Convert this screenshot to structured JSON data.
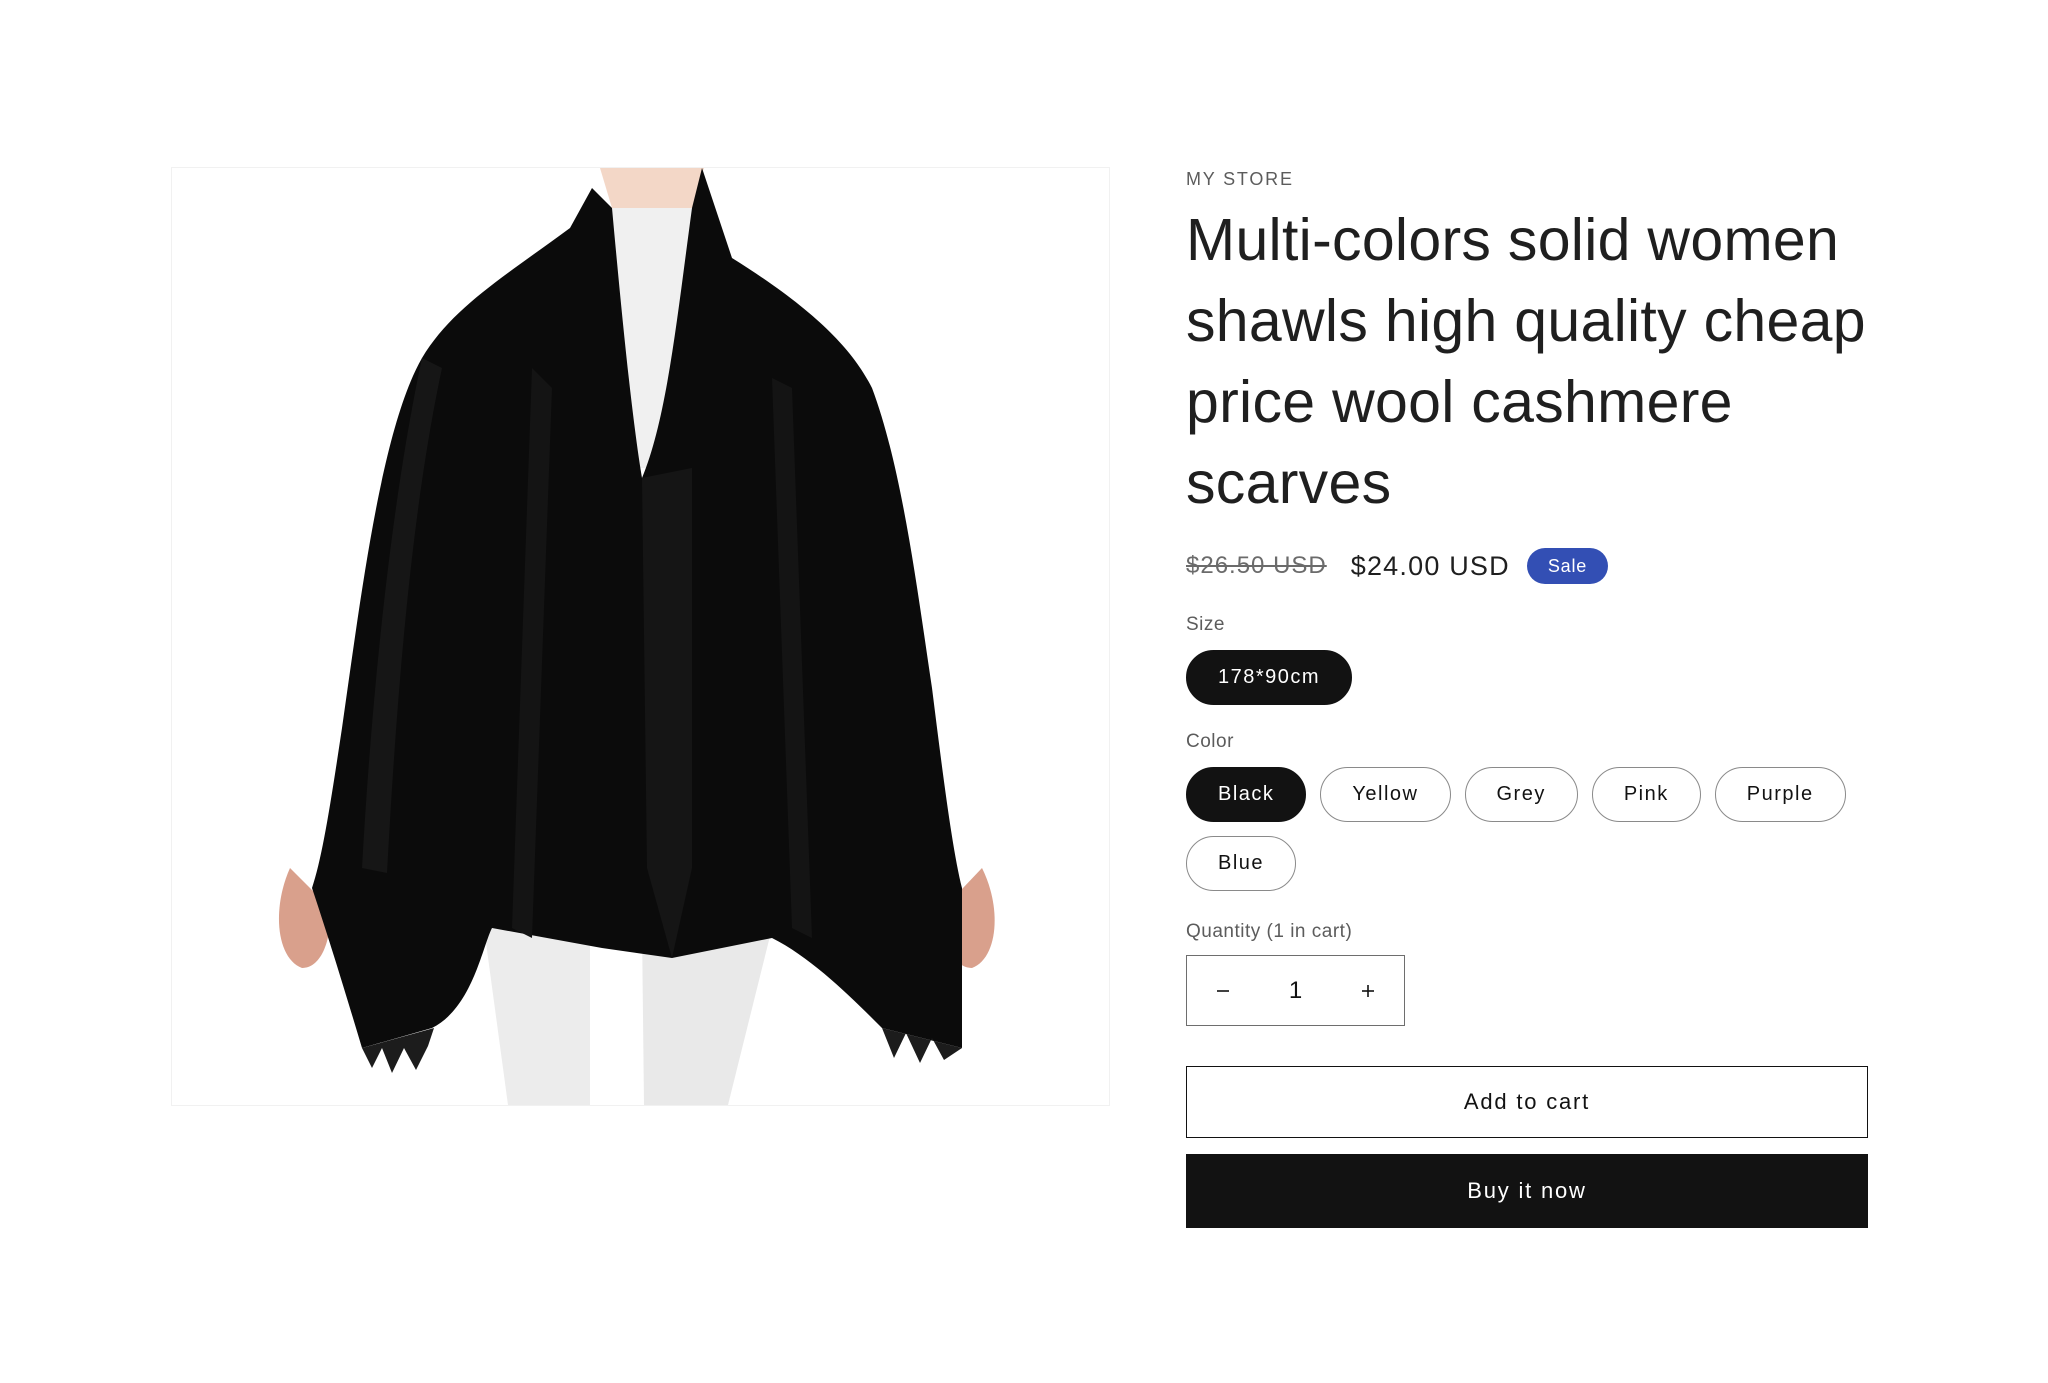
{
  "product": {
    "vendor": "MY STORE",
    "title": "Multi-colors solid women shawls high quality cheap price wool cashmere scarves",
    "image_alt": "product-photo-black-shawl"
  },
  "price": {
    "compare_at": "$26.50 USD",
    "current": "$24.00 USD",
    "badge": "Sale",
    "badge_color": "#334fb4"
  },
  "options": {
    "size": {
      "label": "Size",
      "values": [
        "178*90cm"
      ],
      "selected": "178*90cm"
    },
    "color": {
      "label": "Color",
      "values": [
        "Black",
        "Yellow",
        "Grey",
        "Pink",
        "Purple",
        "Blue"
      ],
      "selected": "Black"
    }
  },
  "quantity": {
    "label": "Quantity (1 in cart)",
    "value": "1",
    "decrease_icon": "minus-icon",
    "increase_icon": "plus-icon"
  },
  "actions": {
    "add_to_cart": "Add to cart",
    "buy_now": "Buy it now"
  },
  "colors": {
    "primary": "#121212",
    "accent": "#334fb4"
  }
}
